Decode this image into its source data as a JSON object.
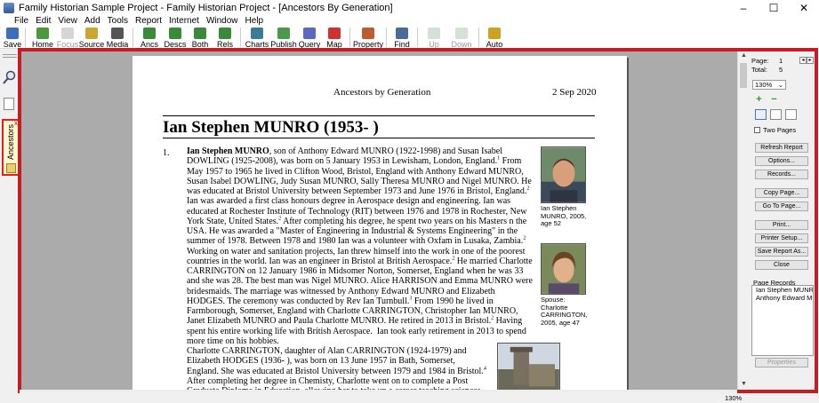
{
  "window": {
    "title": "Family Historian Sample Project - Family Historian Project - [Ancestors By Generation]",
    "controls": [
      "–",
      "☐",
      "✕"
    ]
  },
  "menu": [
    "File",
    "Edit",
    "View",
    "Add",
    "Tools",
    "Report",
    "Internet",
    "Window",
    "Help"
  ],
  "toolbar": [
    {
      "label": "Save",
      "icon": "save-icon",
      "enabled": true
    },
    {
      "label": "Home",
      "icon": "home-icon",
      "enabled": true
    },
    {
      "label": "Focus",
      "icon": "focus-icon",
      "enabled": false
    },
    {
      "label": "Source",
      "icon": "source-icon",
      "enabled": true
    },
    {
      "label": "Media",
      "icon": "media-icon",
      "enabled": true
    },
    {
      "label": "Ancs",
      "icon": "ancestors-icon",
      "enabled": true
    },
    {
      "label": "Descs",
      "icon": "descendants-icon",
      "enabled": true
    },
    {
      "label": "Both",
      "icon": "both-icon",
      "enabled": true
    },
    {
      "label": "Rels",
      "icon": "relatives-icon",
      "enabled": true
    },
    {
      "label": "Charts",
      "icon": "charts-icon",
      "enabled": true
    },
    {
      "label": "Publish",
      "icon": "publish-icon",
      "enabled": true
    },
    {
      "label": "Query",
      "icon": "query-icon",
      "enabled": true
    },
    {
      "label": "Map",
      "icon": "map-icon",
      "enabled": true
    },
    {
      "label": "Property",
      "icon": "property-icon",
      "enabled": true
    },
    {
      "label": "Find",
      "icon": "find-icon",
      "enabled": true
    },
    {
      "label": "Up",
      "icon": "up-icon",
      "enabled": false
    },
    {
      "label": "Down",
      "icon": "down-icon",
      "enabled": false
    },
    {
      "label": "Auto",
      "icon": "auto-icon",
      "enabled": true
    }
  ],
  "left_pane": {
    "tab_label": "Ancestors",
    "tab_close": "x"
  },
  "report": {
    "header_title": "Ancestors by Generation",
    "header_date": "2 Sep 2020",
    "person_heading": "Ian Stephen MUNRO (1953- )",
    "entry_number": "1.",
    "photo1_caption": "Ian Stephen MUNRO, 2005, age 52",
    "photo2_caption": "Spouse: Charlotte CARRINGTON, 2005, age 47"
  },
  "side_panel": {
    "page_label": "Page:",
    "page_value": "1",
    "total_label": "Total:",
    "total_value": "5",
    "zoom": "130%",
    "two_pages": "Two Pages",
    "buttons": [
      "Refresh Report",
      "Options...",
      "Records...",
      "Copy Page...",
      "Go To Page...",
      "Print...",
      "Printer Setup...",
      "Save Report As...",
      "Close"
    ],
    "records_label": "Page Records",
    "records": [
      "Ian Stephen MUNRO",
      "Anthony Edward MU"
    ],
    "properties_button": "Properties"
  },
  "status": {
    "zoom": "130%"
  },
  "colors": {
    "highlight_frame": "#c41e24",
    "page_bg": "#ababab"
  }
}
